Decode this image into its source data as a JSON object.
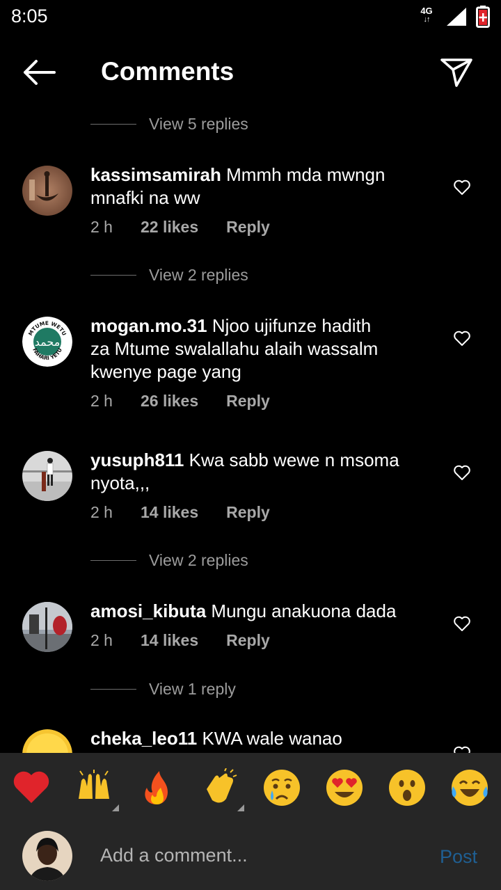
{
  "status_bar": {
    "time": "8:05",
    "network": "4G",
    "network_arrows": "↓↑"
  },
  "header": {
    "title": "Comments"
  },
  "colors": {
    "accent_post": "#1f5f93",
    "heart_red": "#e0242b"
  },
  "view_replies": {
    "r1": "View 5 replies",
    "r2": "View 2 replies",
    "r3": "View 2 replies",
    "r4": "View 1 reply"
  },
  "comments": [
    {
      "username": "kassimsamirah",
      "text_lines": [
        "Mmmh mda mwngn",
        "mnafki na ww"
      ],
      "time": "2 h",
      "likes": "22 likes",
      "reply": "Reply"
    },
    {
      "username": "mogan.mo.31",
      "text_lines": [
        "Njoo ujifunze hadith",
        "za Mtume swalallahu alaih wassalm",
        "kwenye page yang"
      ],
      "time": "2 h",
      "likes": "26 likes",
      "reply": "Reply",
      "avatar_badge_top": "MTUME WETU",
      "avatar_badge_bottom": "FAHARI YETU"
    },
    {
      "username": "yusuph811",
      "text_lines": [
        "Kwa sabb wewe n msoma",
        "nyota,,,"
      ],
      "time": "2 h",
      "likes": "14 likes",
      "reply": "Reply"
    },
    {
      "username": "amosi_kibuta",
      "text_lines": [
        "Mungu anakuona dada"
      ],
      "time": "2 h",
      "likes": "14 likes",
      "reply": "Reply"
    },
    {
      "username": "cheka_leo11",
      "text_lines": [
        "KWA wale wanao"
      ],
      "time": "",
      "likes": "",
      "reply": ""
    }
  ],
  "emoji_bar": [
    "❤️",
    "🙌",
    "🔥",
    "👏",
    "😢",
    "😍",
    "😮",
    "😂"
  ],
  "composer": {
    "placeholder": "Add a comment...",
    "post_label": "Post"
  }
}
